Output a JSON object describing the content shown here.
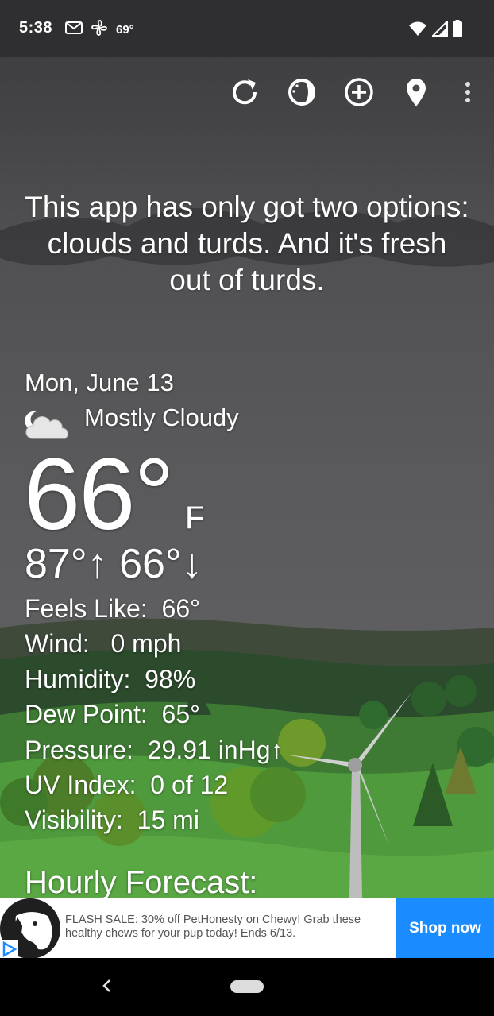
{
  "status_bar": {
    "time": "5:38",
    "temperature": "69°",
    "icons_left": [
      "gmail-icon",
      "fan-icon"
    ],
    "icons_right": [
      "wifi-icon",
      "signal-icon",
      "battery-icon"
    ]
  },
  "toolbar": {
    "buttons": [
      "refresh-icon",
      "theme-icon",
      "add-location-icon",
      "location-pin-icon",
      "more-options-icon"
    ]
  },
  "joke": "This app has only got two options: clouds and turds. And it's fresh out of turds.",
  "weather": {
    "date": "Mon, June 13",
    "condition": "Mostly Cloudy",
    "condition_icon": "partly-cloudy-night-icon",
    "temperature": "66°",
    "unit": "F",
    "hilo": "87°↑ 66°↓",
    "details": [
      {
        "label": "Feels Like:",
        "value": "66°"
      },
      {
        "label": "Wind:",
        "value": " 0 mph"
      },
      {
        "label": "Humidity:",
        "value": "98%"
      },
      {
        "label": "Dew Point:",
        "value": "65°"
      },
      {
        "label": "Pressure:",
        "value": "29.91 inHg↑"
      },
      {
        "label": "UV Index:",
        "value": "0 of 12"
      },
      {
        "label": "Visibility:",
        "value": "15 mi"
      }
    ],
    "hourly_title": "Hourly Forecast:"
  },
  "ad": {
    "text": "FLASH SALE: 30% off PetHonesty on Chewy! Grab these healthy chews for your pup today! Ends 6/13.",
    "cta": "Shop now",
    "cta_color": "#1a8cff"
  },
  "colors": {
    "status_bar": "#2f2f31",
    "sky_top": "#3b3b3d",
    "hill_dark": "#2f4a2a",
    "hill_light": "#4f8a3c",
    "foreground": "#5da844"
  }
}
